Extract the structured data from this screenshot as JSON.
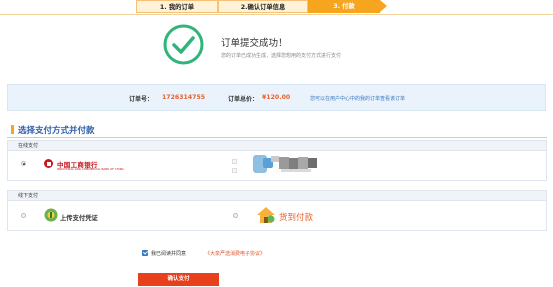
{
  "steps": [
    {
      "label": "1. 我的订单"
    },
    {
      "label": "2.确认订单信息"
    },
    {
      "label": "3. 付款"
    }
  ],
  "success": {
    "title": "订单提交成功！",
    "subtitle": "您的订单已成功生成，选择您想用的支付方式进行支付"
  },
  "order": {
    "number_label": "订单号：",
    "number": "1726314755",
    "total_label": "订单总价：",
    "total": "¥120.00",
    "link": "您可以在用户中心中的我的订单查看该订单"
  },
  "payment": {
    "section_title": "选择支付方式并付款",
    "online_label": "在线支付",
    "offline_label": "线下支付",
    "bank_name": "中国工商银行",
    "bank_sub": "INDUSTRIAL AND COMMERCIAL BANK OF CHINA",
    "offline_option": "上传支付凭证",
    "cod_option": "货到付款"
  },
  "agreement": {
    "text": "我已阅读并同意",
    "link": "《大泉严选消费电子协议》"
  },
  "pay_button": "确认支付",
  "colors": {
    "accent_orange": "#f7a51e",
    "price_red": "#e8612c",
    "button_red": "#e8401c",
    "link_blue": "#3a77c0",
    "success_green": "#2fb47a"
  }
}
